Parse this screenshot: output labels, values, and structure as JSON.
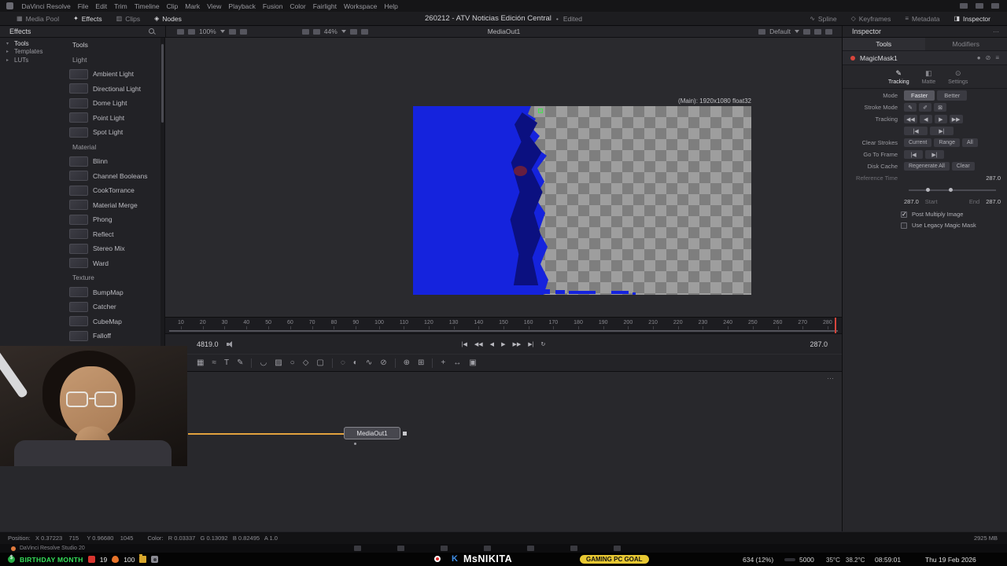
{
  "menu": {
    "items": [
      "DaVinci Resolve",
      "File",
      "Edit",
      "Trim",
      "Timeline",
      "Clip",
      "Mark",
      "View",
      "Playback",
      "Fusion",
      "Color",
      "Fairlight",
      "Workspace",
      "Help"
    ]
  },
  "titlebar": {
    "title": "260212 - ATV Noticias Edición Central",
    "separator": "•",
    "status": "Edited"
  },
  "page_tabs": {
    "left": [
      {
        "label": "Media Pool",
        "glyph": "▦",
        "active": false
      },
      {
        "label": "Effects",
        "glyph": "✦",
        "active": true
      },
      {
        "label": "Clips",
        "glyph": "▥",
        "active": false
      },
      {
        "label": "Nodes",
        "glyph": "◈",
        "active": true
      }
    ],
    "right": [
      {
        "label": "Spline",
        "glyph": "∿",
        "active": false
      },
      {
        "label": "Keyframes",
        "glyph": "◇",
        "active": false
      },
      {
        "label": "Metadata",
        "glyph": "≡",
        "active": false
      },
      {
        "label": "Inspector",
        "glyph": "◨",
        "active": true
      }
    ]
  },
  "effects": {
    "header": "Effects",
    "tree": [
      {
        "label": "Tools",
        "caret": "▾",
        "active": true
      },
      {
        "label": "Templates",
        "caret": "▸",
        "active": false
      },
      {
        "label": "LUTs",
        "caret": "▸",
        "active": false
      }
    ],
    "items": [
      {
        "kind": "root",
        "label": "Tools"
      },
      {
        "kind": "group",
        "label": "Light"
      },
      {
        "kind": "tool",
        "label": "Ambient Light"
      },
      {
        "kind": "tool",
        "label": "Directional Light"
      },
      {
        "kind": "tool",
        "label": "Dome Light"
      },
      {
        "kind": "tool",
        "label": "Point Light"
      },
      {
        "kind": "tool",
        "label": "Spot Light"
      },
      {
        "kind": "group",
        "label": "Material"
      },
      {
        "kind": "tool",
        "label": "Blinn"
      },
      {
        "kind": "tool",
        "label": "Channel Booleans"
      },
      {
        "kind": "tool",
        "label": "CookTorrance"
      },
      {
        "kind": "tool",
        "label": "Material Merge"
      },
      {
        "kind": "tool",
        "label": "Phong"
      },
      {
        "kind": "tool",
        "label": "Reflect"
      },
      {
        "kind": "tool",
        "label": "Stereo Mix"
      },
      {
        "kind": "tool",
        "label": "Ward"
      },
      {
        "kind": "group",
        "label": "Texture"
      },
      {
        "kind": "tool",
        "label": "BumpMap"
      },
      {
        "kind": "tool",
        "label": "Catcher"
      },
      {
        "kind": "tool",
        "label": "CubeMap"
      },
      {
        "kind": "tool",
        "label": "Falloff"
      }
    ]
  },
  "viewer": {
    "zoom_a": "100%",
    "zoom_b": "44%",
    "name": "MediaOut1",
    "lut": "Default",
    "overlay": "(Main): 1920x1080 float32"
  },
  "ruler": {
    "labels": [
      "10",
      "20",
      "30",
      "40",
      "50",
      "60",
      "70",
      "80",
      "90",
      "100",
      "110",
      "120",
      "130",
      "140",
      "150",
      "160",
      "170",
      "180",
      "190",
      "200",
      "210",
      "220",
      "230",
      "240",
      "250",
      "260",
      "270",
      "280"
    ]
  },
  "transport": {
    "time_left": "4819.0",
    "time_right": "287.0",
    "buttons": [
      {
        "name": "go-to-start-button",
        "glyph": "|◀"
      },
      {
        "name": "step-back-button",
        "glyph": "◀◀"
      },
      {
        "name": "play-reverse-button",
        "glyph": "◀"
      },
      {
        "name": "play-button",
        "glyph": "▶"
      },
      {
        "name": "step-forward-button",
        "glyph": "▶▶"
      },
      {
        "name": "go-to-end-button",
        "glyph": "▶|"
      },
      {
        "name": "loop-button",
        "glyph": "↻"
      }
    ]
  },
  "fusion_toolbar": {
    "tools": [
      {
        "kind": "tool",
        "name": "background-tool",
        "glyph": "▦"
      },
      {
        "kind": "tool",
        "name": "fastnoise-tool",
        "glyph": "≈"
      },
      {
        "kind": "tool",
        "name": "text-plus-tool",
        "glyph": "T"
      },
      {
        "kind": "tool",
        "name": "paint-tool",
        "glyph": "✎"
      },
      {
        "kind": "divider",
        "name": "toolbar-divider"
      },
      {
        "kind": "tool",
        "name": "bspline-mask-tool",
        "glyph": "◡"
      },
      {
        "kind": "tool",
        "name": "bitmap-mask-tool",
        "glyph": "▨"
      },
      {
        "kind": "tool",
        "name": "ellipse-mask-tool",
        "glyph": "○"
      },
      {
        "kind": "tool",
        "name": "polygon-mask-tool",
        "glyph": "◇"
      },
      {
        "kind": "tool",
        "name": "rectangle-mask-tool",
        "glyph": "▢"
      },
      {
        "kind": "divider",
        "name": "toolbar-divider"
      },
      {
        "kind": "tool",
        "name": "blur-tool",
        "glyph": "◌"
      },
      {
        "kind": "tool",
        "name": "color-corrector-tool",
        "glyph": "◐"
      },
      {
        "kind": "tool",
        "name": "curves-tool",
        "glyph": "∿"
      },
      {
        "k": 0,
        "kind": "tool",
        "name": "delta-keyer-tool",
        "glyph": "⊘"
      },
      {
        "kind": "divider",
        "name": "toolbar-divider"
      },
      {
        "kind": "tool",
        "name": "merge-tool",
        "glyph": "⊕"
      },
      {
        "kind": "tool",
        "name": "transform-tool",
        "glyph": "⊞"
      },
      {
        "kind": "divider",
        "name": "toolbar-divider"
      },
      {
        "kind": "tool",
        "name": "tracker-tool",
        "glyph": "+"
      },
      {
        "kind": "tool",
        "name": "resize-tool",
        "glyph": "↔"
      },
      {
        "kind": "tool",
        "name": "crop-tool",
        "glyph": "▣"
      }
    ]
  },
  "node_graph": {
    "node_label": "MediaOut1",
    "overflow_icon": "⋯"
  },
  "inspector": {
    "header": "Inspector",
    "tabs": [
      {
        "label": "Tools",
        "active": true
      },
      {
        "label": "Modifiers",
        "active": false
      }
    ],
    "node_name": "MagicMask1",
    "subtabs": [
      {
        "label": "Tracking",
        "glyph": "✎",
        "active": true
      },
      {
        "label": "Matte",
        "glyph": "◧",
        "active": false
      },
      {
        "label": "Settings",
        "glyph": "⊙",
        "active": false
      }
    ],
    "mode": {
      "label": "Mode",
      "options": [
        {
          "label": "Faster",
          "active": true
        },
        {
          "label": "Better",
          "active": false
        }
      ]
    },
    "stroke_mode_label": "Stroke Mode",
    "stroke_buttons": [
      {
        "name": "draw-stroke-button",
        "glyph": "✎"
      },
      {
        "name": "smart-stroke-button",
        "glyph": "✐"
      },
      {
        "name": "erase-stroke-button",
        "glyph": "⊠"
      }
    ],
    "tracking_label": "Tracking",
    "tracking_buttons_row1": [
      {
        "name": "track-backward-button",
        "glyph": "◀◀"
      },
      {
        "name": "track-one-backward-button",
        "glyph": "◀"
      },
      {
        "name": "track-one-forward-button",
        "glyph": "▶"
      },
      {
        "name": "track-forward-button",
        "glyph": "▶▶"
      }
    ],
    "tracking_buttons_row2": [
      {
        "name": "track-to-start-button",
        "glyph": "|◀"
      },
      {
        "name": "track-to-end-button",
        "glyph": "▶|"
      }
    ],
    "clear_strokes": {
      "label": "Clear Strokes",
      "buttons": [
        "Current",
        "Range",
        "All"
      ]
    },
    "go_to_frame_label": "Go To Frame",
    "go_to_frame_buttons": [
      {
        "name": "go-previous-frame-button",
        "glyph": "|◀"
      },
      {
        "name": "go-next-frame-button",
        "glyph": "▶|"
      }
    ],
    "disk_cache": {
      "label": "Disk Cache",
      "buttons": [
        "Regenerate All",
        "Clear"
      ]
    },
    "reference": {
      "label": "Reference Time",
      "value": "287.0"
    },
    "range": {
      "start_value": "287.0",
      "start_label": "Start",
      "end_label": "End",
      "end_value": "287.0"
    },
    "post_multiply": {
      "label": "Post Multiply Image",
      "checked": true
    },
    "legacy": {
      "label": "Use Legacy Magic Mask",
      "checked": false
    }
  },
  "status_bar": {
    "position_text": "Position:   X 0.37223    715     Y 0.96680    1045",
    "color_text": "Color:   R 0.03337   G 0.13092   B 0.82495   A 1.0",
    "memory": "2925 MB"
  },
  "footer": {
    "app_label": "DaVinci Resolve Studio 20"
  },
  "stream": {
    "birthday_text": "BIRTHDAY MONTH",
    "count_a": "19",
    "count_b": "100",
    "kick_letter": "K",
    "channel": "MsNIKITA",
    "goal_badge": "GAMING PC GOAL",
    "goal_current": "634 (12%)",
    "goal_target": "5000",
    "temp_a": "35°C",
    "temp_b": "38.2°C",
    "clock": "08:59:01",
    "date": "Thu 19 Feb 2026"
  }
}
